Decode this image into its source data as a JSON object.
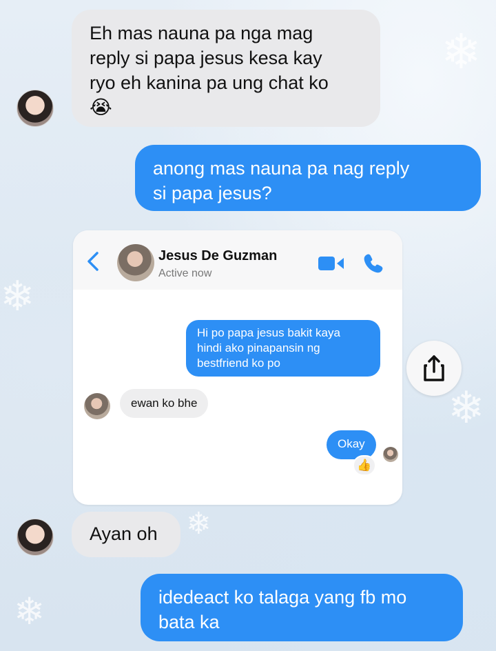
{
  "messages": [
    {
      "lines": [
        "Eh mas nauna pa nga mag",
        "reply si papa jesus kesa kay",
        "ryo eh kanina pa ung chat ko",
        "😭"
      ]
    },
    {
      "lines": [
        "anong mas nauna pa nag reply",
        "si papa jesus?"
      ]
    },
    {
      "text": "Ayan oh"
    },
    {
      "lines": [
        "idedeact ko talaga yang fb mo",
        "bata ka"
      ]
    }
  ],
  "embedded_chat": {
    "contact_name": "Jesus De Guzman",
    "status": "Active now",
    "messages": [
      {
        "lines": [
          "Hi po papa jesus bakit kaya",
          "hindi ako pinapansin ng",
          "bestfriend ko po"
        ]
      },
      {
        "text": "ewan ko bhe"
      },
      {
        "text": "Okay"
      }
    ],
    "reaction": "👍"
  },
  "icons": {
    "back": "chevron-left-icon",
    "video": "video-camera-icon",
    "phone": "phone-icon",
    "share": "share-icon",
    "reaction": "thumbs-up-icon"
  },
  "colors": {
    "outgoing_bubble": "#2d8ff5",
    "incoming_bubble": "#e9e9eb",
    "accent_blue": "#2d8ff5"
  }
}
